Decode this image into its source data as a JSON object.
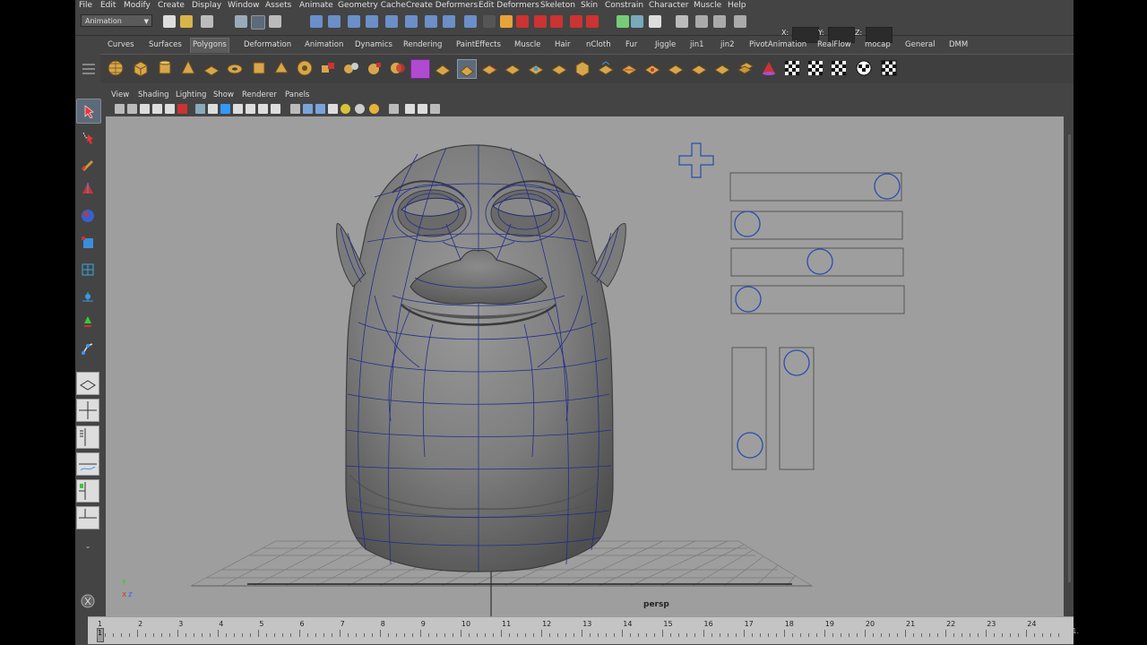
{
  "menubar": {
    "items": [
      "File",
      "Edit",
      "Modify",
      "Create",
      "Display",
      "Window",
      "Assets",
      "Animate",
      "Geometry Cache",
      "Create Deformers",
      "Edit Deformers",
      "Skeleton",
      "Skin",
      "Constrain",
      "Character",
      "Muscle",
      "Help"
    ]
  },
  "statusline": {
    "mode": "Animation",
    "x_label": "X:",
    "y_label": "Y:",
    "z_label": "Z:"
  },
  "shelf": {
    "tabs": [
      "Curves",
      "Surfaces",
      "Polygons",
      "Deformation",
      "Animation",
      "Dynamics",
      "Rendering",
      "PaintEffects",
      "Muscle",
      "Hair",
      "nCloth",
      "Fur",
      "Jiggle",
      "jin1",
      "jin2",
      "PivotAnimation",
      "RealFlow",
      "mocap",
      "General",
      "DMM"
    ],
    "active_tab": "Polygons"
  },
  "panel": {
    "menu": [
      "View",
      "Shading",
      "Lighting",
      "Show",
      "Renderer",
      "Panels"
    ],
    "camera_label": "persp",
    "axis_x": "x",
    "axis_y": "y",
    "axis_z": "z"
  },
  "timeline": {
    "ticks": [
      "1",
      "2",
      "3",
      "4",
      "5",
      "6",
      "7",
      "8",
      "9",
      "10",
      "11",
      "12",
      "13",
      "14",
      "15",
      "16",
      "17",
      "18",
      "19",
      "20",
      "21",
      "22",
      "23",
      "24"
    ],
    "current_frame": "1",
    "end_label": "1."
  },
  "colors": {
    "viewport_bg": "#9e9e9e",
    "wireframe": "#1f2a8a",
    "ui_bg": "#444444",
    "selection_blue": "#5d6a79"
  }
}
